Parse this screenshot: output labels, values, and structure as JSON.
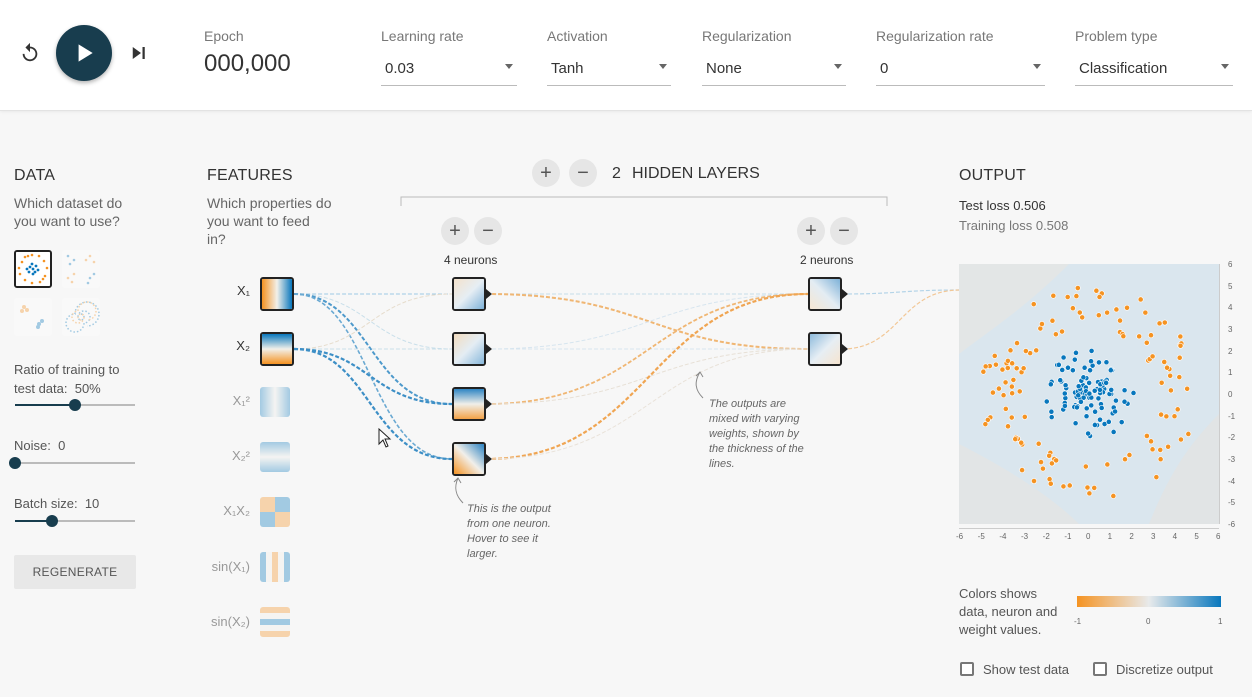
{
  "header": {
    "epoch_label": "Epoch",
    "epoch_value": "000,000",
    "learning_rate": {
      "label": "Learning rate",
      "value": "0.03"
    },
    "activation": {
      "label": "Activation",
      "value": "Tanh"
    },
    "regularization": {
      "label": "Regularization",
      "value": "None"
    },
    "regularization_rate": {
      "label": "Regularization rate",
      "value": "0"
    },
    "problem_type": {
      "label": "Problem type",
      "value": "Classification"
    }
  },
  "data_panel": {
    "title": "DATA",
    "subtitle": "Which dataset do you want to use?",
    "ratio_label": "Ratio of training to test data:",
    "ratio_value": "50%",
    "ratio_fraction": 0.5,
    "noise_label": "Noise:",
    "noise_value": "0",
    "noise_fraction": 0.0,
    "batch_label": "Batch size:",
    "batch_value": "10",
    "batch_fraction": 0.3,
    "regenerate_label": "REGENERATE"
  },
  "features_panel": {
    "title": "FEATURES",
    "subtitle": "Which properties do you want to feed in?",
    "features": [
      {
        "label": "X₁",
        "active": true
      },
      {
        "label": "X₂",
        "active": true
      },
      {
        "label": "X₁²",
        "active": false
      },
      {
        "label": "X₂²",
        "active": false
      },
      {
        "label": "X₁X₂",
        "active": false
      },
      {
        "label": "sin(X₁)",
        "active": false
      },
      {
        "label": "sin(X₂)",
        "active": false
      }
    ]
  },
  "network": {
    "layers_count": "2",
    "layers_label": "HIDDEN LAYERS",
    "layer1_neurons": "4 neurons",
    "layer2_neurons": "2 neurons",
    "annotation_output": "This is the output from one neuron. Hover to see it larger.",
    "annotation_weights": "The outputs are mixed with varying weights, shown by the thickness of the lines."
  },
  "output_panel": {
    "title": "OUTPUT",
    "test_loss_label": "Test loss",
    "test_loss_value": "0.506",
    "training_loss_label": "Training loss",
    "training_loss_value": "0.508",
    "x_ticks": [
      "-6",
      "-5",
      "-4",
      "-3",
      "-2",
      "-1",
      "0",
      "1",
      "2",
      "3",
      "4",
      "5",
      "6"
    ],
    "y_ticks": [
      "6",
      "5",
      "4",
      "3",
      "2",
      "1",
      "0",
      "-1",
      "-2",
      "-3",
      "-4",
      "-5",
      "-6"
    ],
    "legend_text": "Colors shows data, neuron and weight values.",
    "legend_ticks": [
      "-1",
      "0",
      "1"
    ],
    "show_test_label": "Show test data",
    "discretize_label": "Discretize output"
  },
  "colors": {
    "orange": "#f59322",
    "blue": "#0877bd",
    "dark": "#183d4e"
  }
}
